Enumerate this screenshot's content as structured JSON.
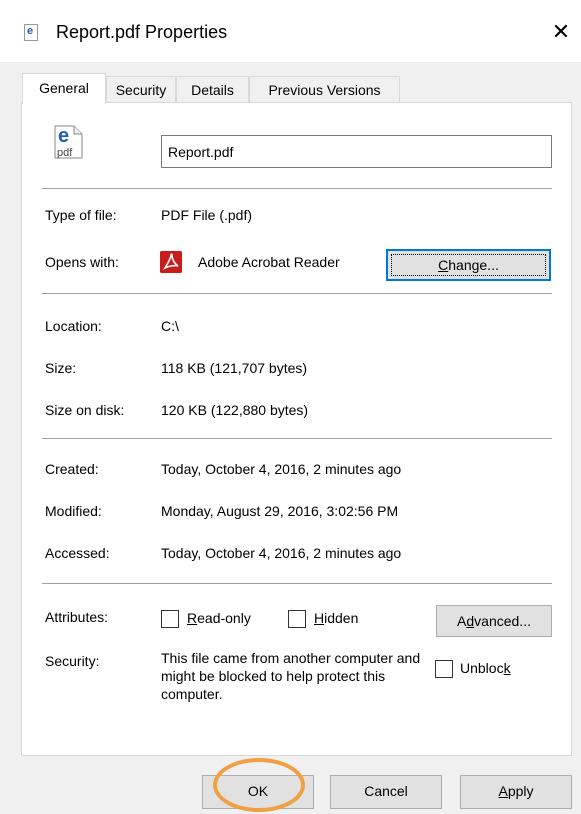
{
  "window": {
    "title": "Report.pdf Properties",
    "close_glyph": "✕"
  },
  "tabs": [
    {
      "label": "General",
      "active": true
    },
    {
      "label": "Security",
      "active": false
    },
    {
      "label": "Details",
      "active": false
    },
    {
      "label": "Previous Versions",
      "active": false
    }
  ],
  "general": {
    "file_icon_top": "e",
    "file_icon_bottom": "pdf",
    "filename": "Report.pdf",
    "type_label": "Type of file:",
    "type_value": "PDF File (.pdf)",
    "opens_label": "Opens with:",
    "opens_value": "Adobe Acrobat Reader",
    "change_button": {
      "prefix": "",
      "accel": "C",
      "suffix": "hange..."
    },
    "location_label": "Location:",
    "location_value": "C:\\",
    "size_label": "Size:",
    "size_value": "118 KB (121,707 bytes)",
    "size_disk_label": "Size on disk:",
    "size_disk_value": "120 KB (122,880 bytes)",
    "created_label": "Created:",
    "created_value": "Today, October 4, 2016, 2 minutes ago",
    "modified_label": "Modified:",
    "modified_value": "Monday, August 29, 2016, 3:02:56 PM",
    "accessed_label": "Accessed:",
    "accessed_value": "Today, October 4, 2016, 2 minutes ago",
    "attributes_label": "Attributes:",
    "readonly": {
      "accel": "R",
      "rest": "ead-only",
      "checked": false
    },
    "hidden": {
      "accel": "H",
      "rest": "idden",
      "checked": false
    },
    "advanced_button": {
      "prefix": "A",
      "accel": "d",
      "suffix": "vanced..."
    },
    "security_label": "Security:",
    "security_text": "This file came from another computer and might be blocked to help protect this computer.",
    "unblock": {
      "prefix": "Unbloc",
      "accel": "k",
      "suffix": "",
      "checked": false
    }
  },
  "buttons": {
    "ok": "OK",
    "cancel": "Cancel",
    "apply": {
      "prefix": "",
      "accel": "A",
      "suffix": "pply"
    }
  },
  "colors": {
    "focus_blue": "#0078d7",
    "highlight_orange": "#f0a042",
    "acrobat_red": "#c91c1c"
  }
}
